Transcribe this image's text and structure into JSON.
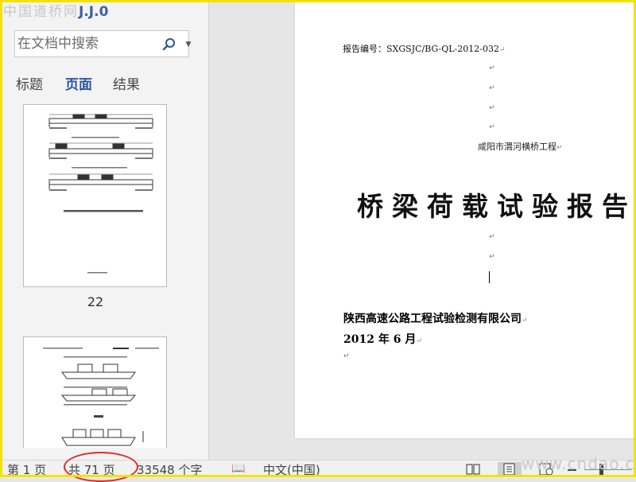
{
  "watermark": {
    "text": "中国道桥网",
    "logo_fragment": "J.J.0"
  },
  "nav": {
    "search": {
      "placeholder": "在文档中搜索",
      "value": ""
    },
    "tabs": [
      {
        "label": "标题",
        "active": false
      },
      {
        "label": "页面",
        "active": true
      },
      {
        "label": "结果",
        "active": false
      }
    ],
    "thumbnails": [
      {
        "page_number": "22"
      },
      {
        "page_number": ""
      }
    ]
  },
  "document": {
    "report_no": "报告编号：SXGSJC/BG-QL-2012-032",
    "subtitle": "咸阳市渭河横桥工程",
    "title": "桥梁荷载试验报告",
    "company": "陕西高速公路工程试验检测有限公司",
    "date": "2012 年 6 月",
    "para_mark": "↵"
  },
  "status": {
    "page": "第 1 页",
    "total": "共 71 页",
    "words": "33548 个字",
    "language": "中文(中国)",
    "site": "www.cndao.com"
  },
  "colors": {
    "accent": "#2b579a",
    "frame": "#f4e10c",
    "highlight_ring": "#e02a2a"
  }
}
